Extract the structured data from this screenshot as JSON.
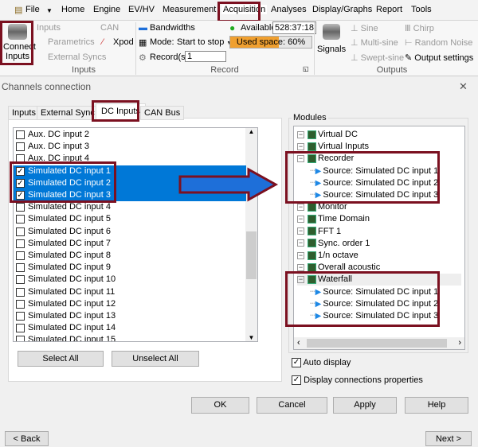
{
  "ribbon": {
    "tabs": [
      "File",
      "Home",
      "Engine",
      "EV/HV",
      "Measurement",
      "Acquisition",
      "Analyses",
      "Display/Graphs",
      "Report",
      "Tools"
    ],
    "active_tab": "Acquisition",
    "connect_inputs": "Connect Inputs",
    "inputs_group": {
      "label": "Inputs",
      "items": [
        "Inputs",
        "Parametrics",
        "External Syncs",
        "CAN",
        "Xpod"
      ]
    },
    "record_group": {
      "label": "Record",
      "bandwidths": "Bandwidths",
      "mode_label": "Mode:",
      "mode_value": "Start to stop",
      "records_label": "Record(s)",
      "records_value": "1",
      "available_label": "Available",
      "available_value": "528:37:18",
      "used_space": "Used space: 60%",
      "used_space_percent": 60
    },
    "outputs_group": {
      "label": "Outputs",
      "signals": "Signals",
      "items": [
        "Sine",
        "Multi-sine",
        "Swept-sine",
        "Chirp",
        "Random Noise",
        "Output settings"
      ]
    }
  },
  "dialog": {
    "title": "Channels connection",
    "tabs": [
      "Inputs",
      "External Sync",
      "DC Inputs",
      "CAN Bus"
    ],
    "active_tab": "DC Inputs",
    "channels": [
      {
        "label": "Aux. DC input 2",
        "checked": false,
        "selected": false
      },
      {
        "label": "Aux. DC input 3",
        "checked": false,
        "selected": false
      },
      {
        "label": "Aux. DC input 4",
        "checked": false,
        "selected": false
      },
      {
        "label": "Simulated DC input 1",
        "checked": true,
        "selected": true
      },
      {
        "label": "Simulated DC input 2",
        "checked": true,
        "selected": true
      },
      {
        "label": "Simulated DC input 3",
        "checked": true,
        "selected": true
      },
      {
        "label": "Simulated DC input 4",
        "checked": false,
        "selected": false
      },
      {
        "label": "Simulated DC input 5",
        "checked": false,
        "selected": false
      },
      {
        "label": "Simulated DC input 6",
        "checked": false,
        "selected": false
      },
      {
        "label": "Simulated DC input 7",
        "checked": false,
        "selected": false
      },
      {
        "label": "Simulated DC input 8",
        "checked": false,
        "selected": false
      },
      {
        "label": "Simulated DC input 9",
        "checked": false,
        "selected": false
      },
      {
        "label": "Simulated DC input 10",
        "checked": false,
        "selected": false
      },
      {
        "label": "Simulated DC input 11",
        "checked": false,
        "selected": false
      },
      {
        "label": "Simulated DC input 12",
        "checked": false,
        "selected": false
      },
      {
        "label": "Simulated DC input 13",
        "checked": false,
        "selected": false
      },
      {
        "label": "Simulated DC input 14",
        "checked": false,
        "selected": false
      },
      {
        "label": "Simulated DC input 15",
        "checked": false,
        "selected": false
      }
    ],
    "select_all": "Select All",
    "unselect_all": "Unselect All",
    "modules_label": "Modules",
    "modules": [
      {
        "label": "Virtual DC",
        "children": []
      },
      {
        "label": "Virtual Inputs",
        "children": []
      },
      {
        "label": "Recorder",
        "children": [
          "Source: Simulated DC input 1",
          "Source: Simulated DC input 2",
          "Source: Simulated DC input 3"
        ]
      },
      {
        "label": "Monitor",
        "children": []
      },
      {
        "label": "Time Domain",
        "children": []
      },
      {
        "label": "FFT 1",
        "children": []
      },
      {
        "label": "Sync. order 1",
        "children": []
      },
      {
        "label": "1/n octave",
        "children": []
      },
      {
        "label": "Overall acoustic",
        "children": []
      },
      {
        "label": "Waterfall",
        "children": [
          "Source: Simulated DC input 1",
          "Source: Simulated DC input 2",
          "Source: Simulated DC input 3"
        ]
      }
    ],
    "auto_display": {
      "label": "Auto display",
      "checked": true
    },
    "display_props": {
      "label": "Display connections properties",
      "checked": true
    },
    "ok": "OK",
    "cancel": "Cancel",
    "apply": "Apply",
    "help": "Help",
    "back": "< Back",
    "next": "Next >",
    "close": "✕"
  },
  "colors": {
    "highlight": "#7b1020",
    "selection": "#0078d7",
    "arrow": "#1e6fd9"
  }
}
